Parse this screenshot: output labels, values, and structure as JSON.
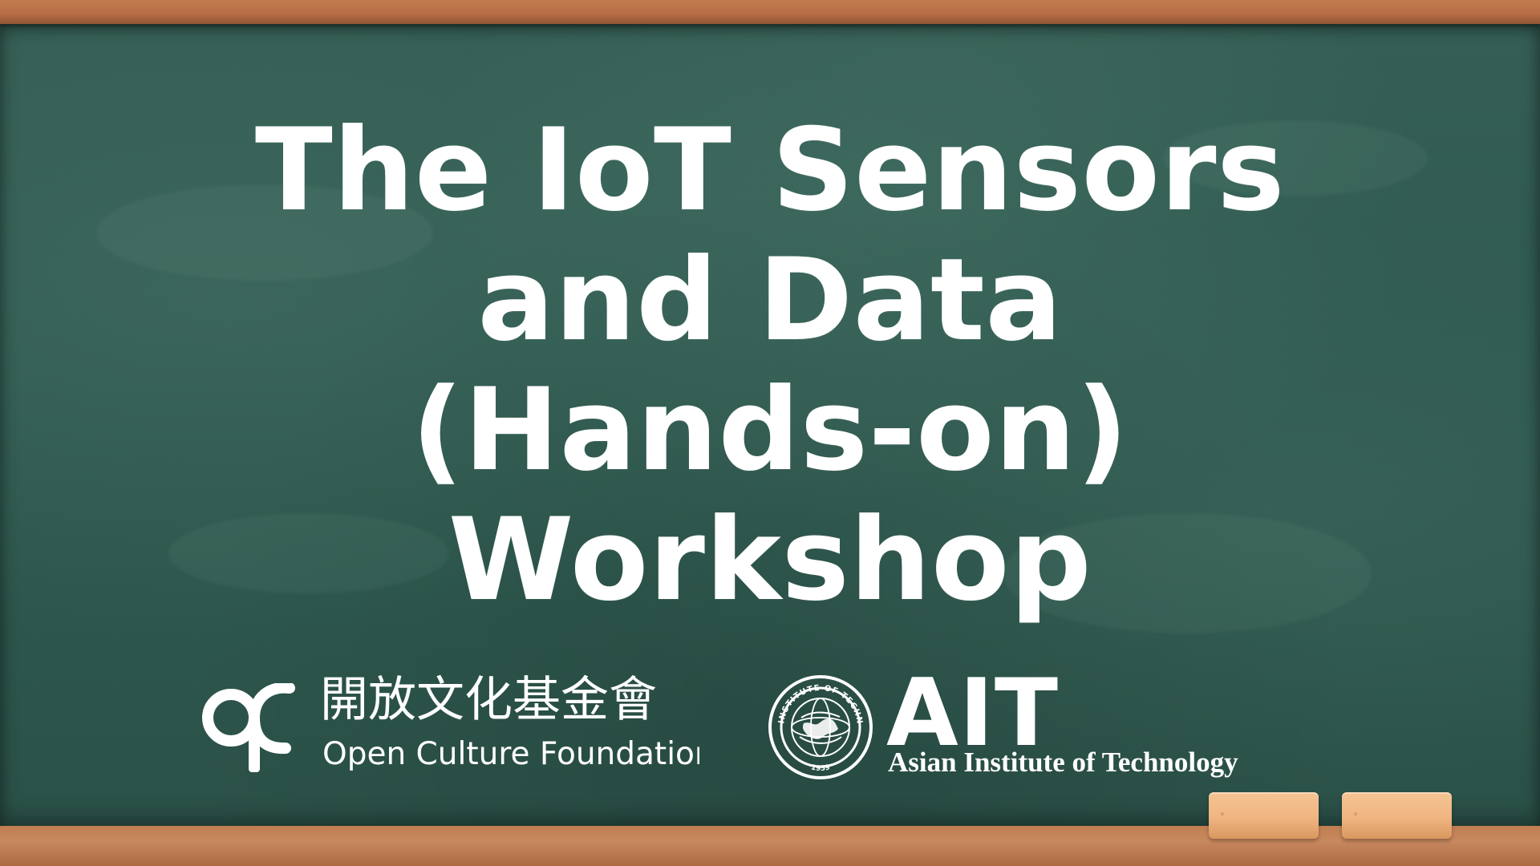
{
  "colors": {
    "chalkboard": "#2f5a50",
    "frame": "#b9774a",
    "chalk_text": "#ffffff",
    "eraser": "#efb582"
  },
  "title": {
    "lines": [
      "The IoT Sensors",
      "and Data",
      "(Hands-on)",
      "Workshop"
    ]
  },
  "logos": {
    "open_culture_foundation": {
      "icon": "ocf-logo-icon",
      "chinese_name": "開放文化基金會",
      "english_name": "Open Culture Foundation"
    },
    "ait": {
      "icon": "ait-seal-icon",
      "acronym": "AIT",
      "full_name": "Asian Institute of Technology",
      "seal_text": "ASIAN INSTITUTE OF TECHNOLOGY",
      "seal_year": "1959"
    }
  }
}
